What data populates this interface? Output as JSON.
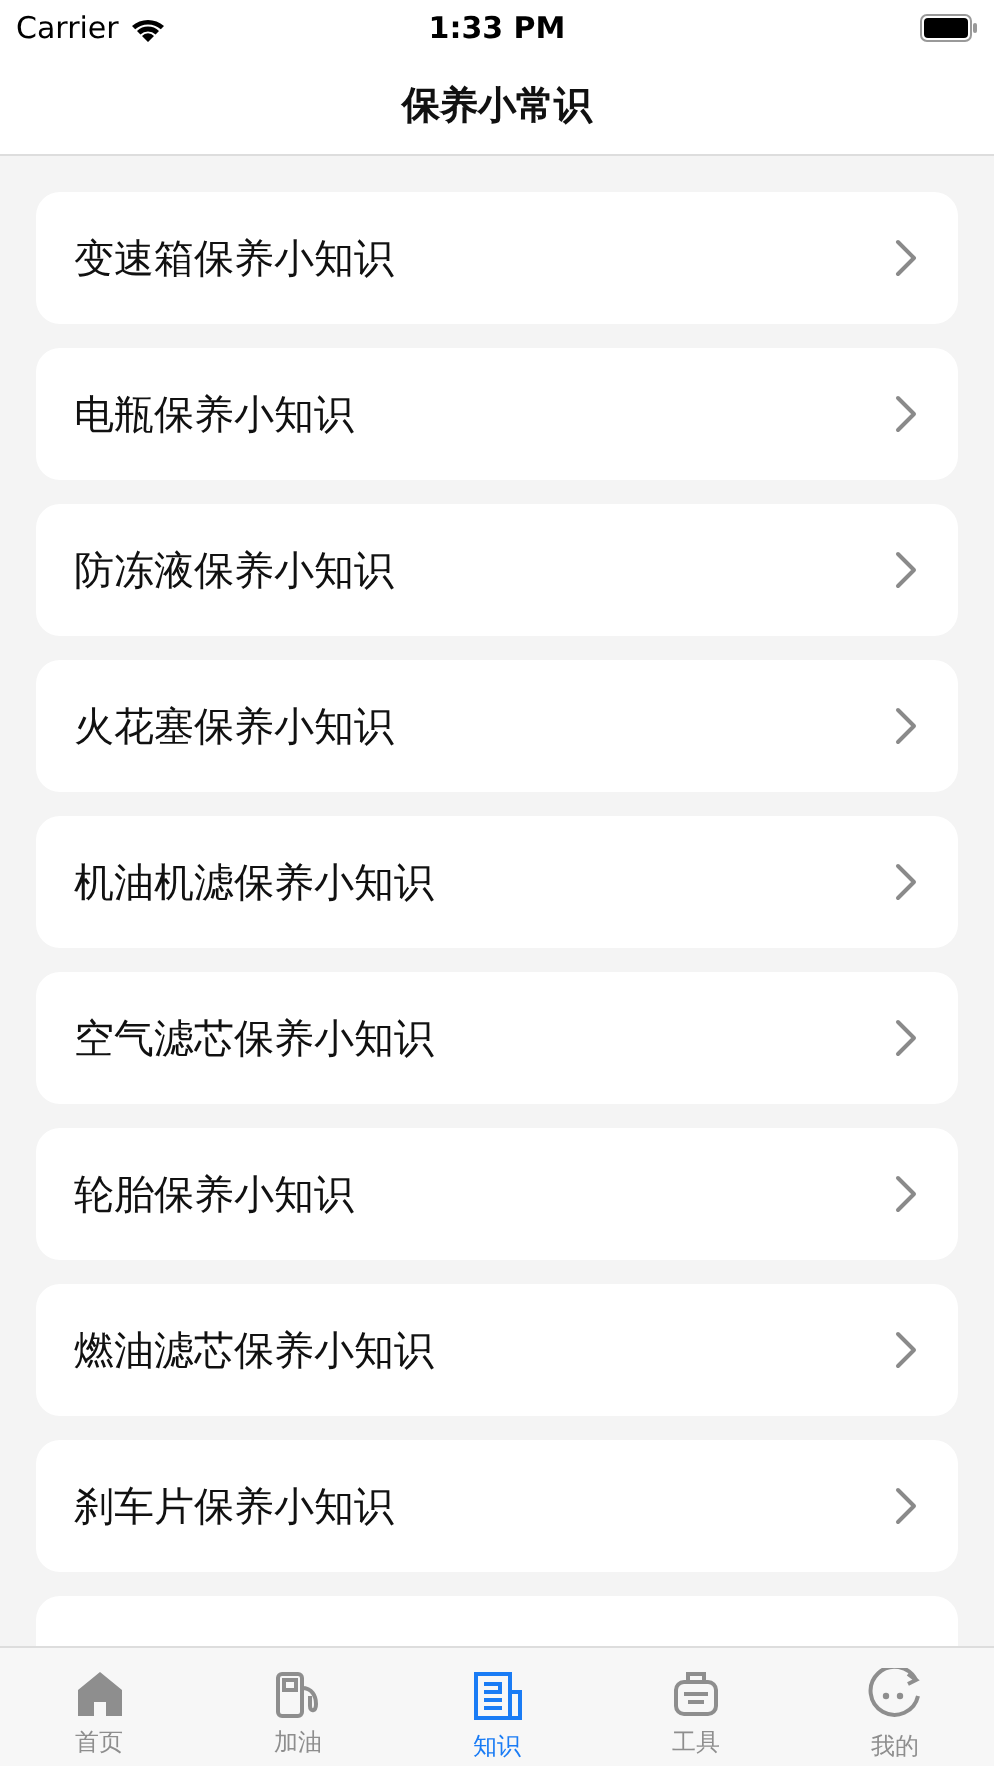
{
  "status_bar": {
    "carrier": "Carrier",
    "time": "1:33 PM"
  },
  "nav": {
    "title": "保养小常识"
  },
  "items": [
    {
      "kind": "row",
      "label": "变速箱保养小知识"
    },
    {
      "kind": "row",
      "label": "电瓶保养小知识"
    },
    {
      "kind": "row",
      "label": "防冻液保养小知识"
    },
    {
      "kind": "row",
      "label": "火花塞保养小知识"
    },
    {
      "kind": "row",
      "label": "机油机滤保养小知识"
    },
    {
      "kind": "row",
      "label": "空气滤芯保养小知识"
    },
    {
      "kind": "row",
      "label": "轮胎保养小知识"
    },
    {
      "kind": "row",
      "label": "燃油滤芯保养小知识"
    },
    {
      "kind": "row",
      "label": "刹车片保养小知识"
    },
    {
      "kind": "clipped"
    }
  ],
  "tabs": [
    {
      "kind": "home",
      "label": "首页",
      "selected": false
    },
    {
      "kind": "fuel",
      "label": "加油",
      "selected": false
    },
    {
      "kind": "news",
      "label": "知识",
      "selected": true
    },
    {
      "kind": "tools",
      "label": "工具",
      "selected": false
    },
    {
      "kind": "me",
      "label": "我的",
      "selected": false
    }
  ]
}
